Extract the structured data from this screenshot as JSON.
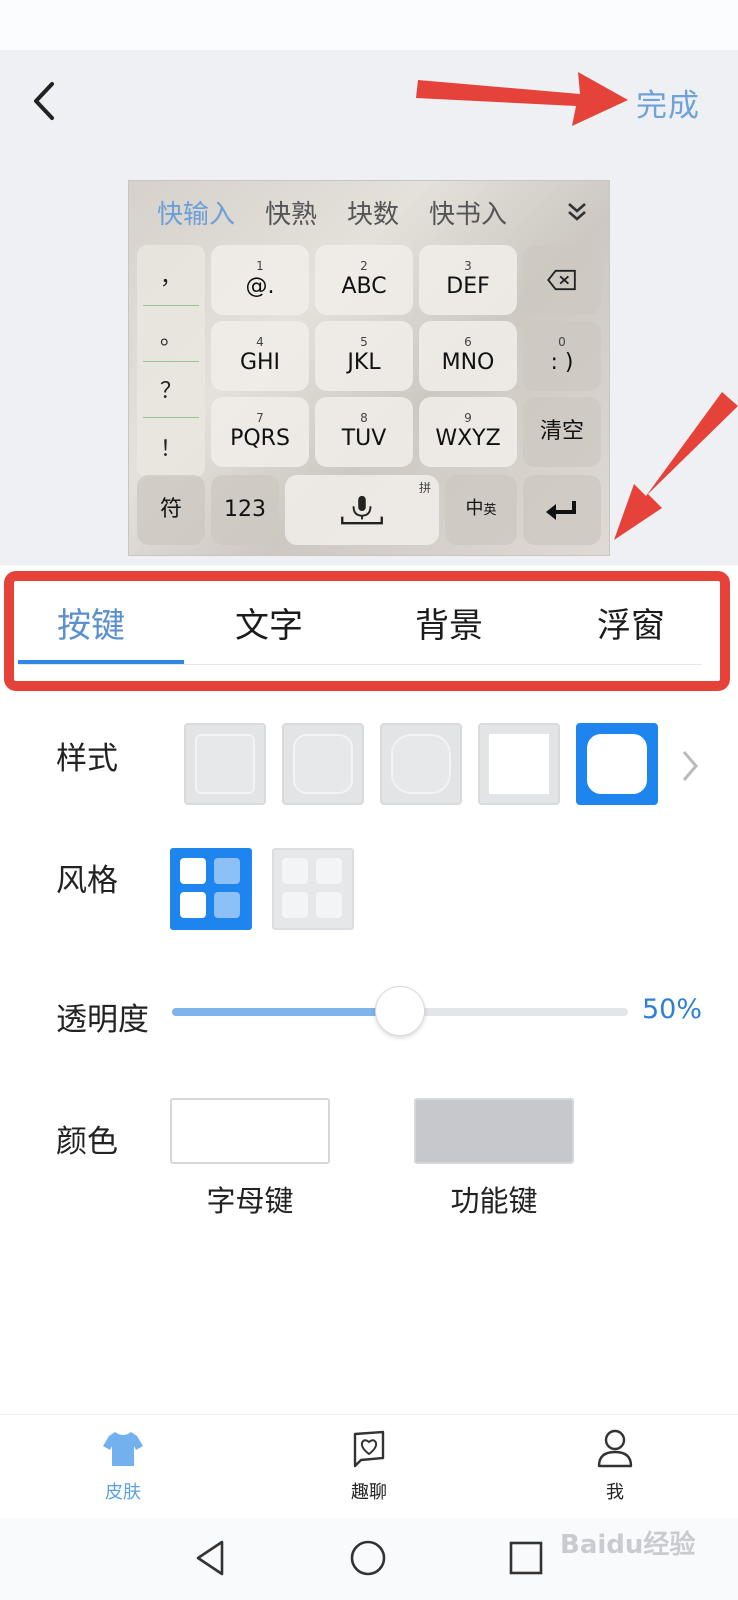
{
  "header": {
    "done_label": "完成"
  },
  "keyboard_preview": {
    "candidates": [
      "快输入",
      "快熟",
      "块数",
      "快书入"
    ],
    "side_symbols": [
      "，",
      "。",
      "？",
      "！"
    ],
    "keys": [
      {
        "num": "1",
        "label": "@."
      },
      {
        "num": "2",
        "label": "ABC"
      },
      {
        "num": "3",
        "label": "DEF"
      },
      {
        "num": "4",
        "label": "GHI"
      },
      {
        "num": "5",
        "label": "JKL"
      },
      {
        "num": "6",
        "label": "MNO"
      },
      {
        "num": "0",
        "label": ": )"
      },
      {
        "num": "7",
        "label": "PQRS"
      },
      {
        "num": "8",
        "label": "TUV"
      },
      {
        "num": "9",
        "label": "WXYZ"
      }
    ],
    "clear_label": "清空",
    "symbol_label": "符",
    "num_label": "123",
    "pinyin_mark": "拼",
    "lang_label_main": "中",
    "lang_label_sub": "英"
  },
  "tabs": [
    {
      "label": "按键",
      "active": true
    },
    {
      "label": "文字",
      "active": false
    },
    {
      "label": "背景",
      "active": false
    },
    {
      "label": "浮窗",
      "active": false
    }
  ],
  "settings": {
    "style_label": "样式",
    "style_selected_index": 4,
    "layout_label": "风格",
    "layout_selected_index": 0,
    "opacity_label": "透明度",
    "opacity_value": "50%",
    "opacity_fraction": 0.5,
    "color_label": "颜色",
    "letter_key_caption": "字母键",
    "letter_key_color": "#ffffff",
    "function_key_caption": "功能键",
    "function_key_color": "#c7c8cc"
  },
  "bottom_nav": [
    {
      "label": "皮肤",
      "icon": "tshirt-icon",
      "active": true
    },
    {
      "label": "趣聊",
      "icon": "chat-heart-icon",
      "active": false
    },
    {
      "label": "我",
      "icon": "person-icon",
      "active": false
    }
  ],
  "colors": {
    "accent": "#1e84ee",
    "annotation_red": "#e5433a",
    "active_tab_text": "#5a8fd0"
  },
  "watermark": "Baidu经验"
}
